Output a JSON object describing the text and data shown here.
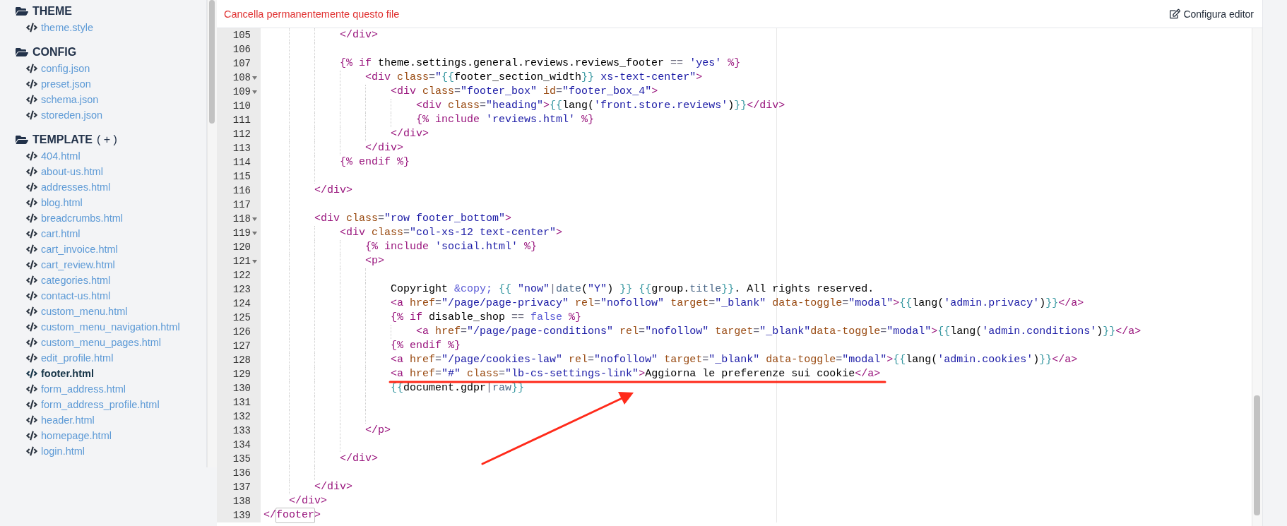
{
  "sidebar": {
    "sections": [
      {
        "title": "THEME",
        "items": [
          {
            "label": "theme.style",
            "selected": false
          }
        ]
      },
      {
        "title": "CONFIG",
        "items": [
          {
            "label": "config.json",
            "selected": false
          },
          {
            "label": "preset.json",
            "selected": false
          },
          {
            "label": "schema.json",
            "selected": false
          },
          {
            "label": "storeden.json",
            "selected": false
          }
        ]
      },
      {
        "title": "TEMPLATE",
        "action": "( + )",
        "items": [
          {
            "label": "404.html",
            "selected": false
          },
          {
            "label": "about-us.html",
            "selected": false
          },
          {
            "label": "addresses.html",
            "selected": false
          },
          {
            "label": "blog.html",
            "selected": false
          },
          {
            "label": "breadcrumbs.html",
            "selected": false
          },
          {
            "label": "cart.html",
            "selected": false
          },
          {
            "label": "cart_invoice.html",
            "selected": false
          },
          {
            "label": "cart_review.html",
            "selected": false
          },
          {
            "label": "categories.html",
            "selected": false
          },
          {
            "label": "contact-us.html",
            "selected": false
          },
          {
            "label": "custom_menu.html",
            "selected": false
          },
          {
            "label": "custom_menu_navigation.html",
            "selected": false
          },
          {
            "label": "custom_menu_pages.html",
            "selected": false
          },
          {
            "label": "edit_profile.html",
            "selected": false
          },
          {
            "label": "footer.html",
            "selected": true
          },
          {
            "label": "form_address.html",
            "selected": false
          },
          {
            "label": "form_address_profile.html",
            "selected": false
          },
          {
            "label": "header.html",
            "selected": false
          },
          {
            "label": "homepage.html",
            "selected": false
          },
          {
            "label": "login.html",
            "selected": false
          }
        ]
      }
    ]
  },
  "header": {
    "delete_link": "Cancella permanentemente questo file",
    "config_button": "Configura editor"
  },
  "editor": {
    "lines": [
      {
        "number": "105",
        "foldable": false,
        "code": [
          {
            "kind": "tag",
            "text": "            </div>"
          }
        ]
      },
      {
        "number": "106",
        "foldable": false
      },
      {
        "number": "107",
        "foldable": false,
        "code": [
          {
            "kind": "tag",
            "text": "            {%"
          },
          {
            "kind": "tag",
            "text": " if"
          },
          {
            "kind": "text",
            "text": " theme.settings.general.reviews.reviews_footer"
          },
          {
            "kind": "op",
            "text": " =="
          },
          {
            "kind": "str",
            "text": " 'yes'"
          },
          {
            "kind": "tag",
            "text": " %}"
          }
        ]
      },
      {
        "number": "108",
        "foldable": true,
        "code": [
          {
            "kind": "tag",
            "text": "                <div"
          },
          {
            "kind": "attr",
            "text": " class"
          },
          {
            "kind": "op",
            "text": "="
          },
          {
            "kind": "str",
            "text": "\""
          },
          {
            "kind": "brace",
            "text": "{{"
          },
          {
            "kind": "text",
            "text": "footer_section_width"
          },
          {
            "kind": "brace",
            "text": "}}"
          },
          {
            "kind": "str",
            "text": " xs-text-center\""
          },
          {
            "kind": "tag",
            "text": ">"
          }
        ]
      },
      {
        "number": "109",
        "foldable": true,
        "code": [
          {
            "kind": "tag",
            "text": "                    <div"
          },
          {
            "kind": "attr",
            "text": " class"
          },
          {
            "kind": "op",
            "text": "="
          },
          {
            "kind": "str",
            "text": "\"footer_box\""
          },
          {
            "kind": "attr",
            "text": " id"
          },
          {
            "kind": "op",
            "text": "="
          },
          {
            "kind": "str",
            "text": "\"footer_box_4\""
          },
          {
            "kind": "tag",
            "text": ">"
          }
        ]
      },
      {
        "number": "110",
        "foldable": false,
        "code": [
          {
            "kind": "tag",
            "text": "                        <div"
          },
          {
            "kind": "attr",
            "text": " class"
          },
          {
            "kind": "op",
            "text": "="
          },
          {
            "kind": "str",
            "text": "\"heading\""
          },
          {
            "kind": "tag",
            "text": ">"
          },
          {
            "kind": "brace",
            "text": "{{"
          },
          {
            "kind": "text",
            "text": "lang("
          },
          {
            "kind": "str",
            "text": "'front.store.reviews'"
          },
          {
            "kind": "text",
            "text": ")"
          },
          {
            "kind": "brace",
            "text": "}}"
          },
          {
            "kind": "tag",
            "text": "</div>"
          }
        ]
      },
      {
        "number": "111",
        "foldable": false,
        "code": [
          {
            "kind": "tag",
            "text": "                        {%"
          },
          {
            "kind": "tag",
            "text": " include"
          },
          {
            "kind": "str",
            "text": " 'reviews.html'"
          },
          {
            "kind": "tag",
            "text": " %}"
          }
        ]
      },
      {
        "number": "112",
        "foldable": false,
        "code": [
          {
            "kind": "tag",
            "text": "                    </div>"
          }
        ]
      },
      {
        "number": "113",
        "foldable": false,
        "code": [
          {
            "kind": "tag",
            "text": "                </div>"
          }
        ]
      },
      {
        "number": "114",
        "foldable": false,
        "code": [
          {
            "kind": "tag",
            "text": "            {%"
          },
          {
            "kind": "tag",
            "text": " endif"
          },
          {
            "kind": "tag",
            "text": " %}"
          }
        ]
      },
      {
        "number": "115",
        "foldable": false
      },
      {
        "number": "116",
        "foldable": false,
        "code": [
          {
            "kind": "tag",
            "text": "        </div>"
          }
        ]
      },
      {
        "number": "117",
        "foldable": false
      },
      {
        "number": "118",
        "foldable": true,
        "code": [
          {
            "kind": "tag",
            "text": "        <div"
          },
          {
            "kind": "attr",
            "text": " class"
          },
          {
            "kind": "op",
            "text": "="
          },
          {
            "kind": "str",
            "text": "\"row footer_bottom\""
          },
          {
            "kind": "tag",
            "text": ">"
          }
        ]
      },
      {
        "number": "119",
        "foldable": true,
        "code": [
          {
            "kind": "tag",
            "text": "            <div"
          },
          {
            "kind": "attr",
            "text": " class"
          },
          {
            "kind": "op",
            "text": "="
          },
          {
            "kind": "str",
            "text": "\"col-xs-12 text-center\""
          },
          {
            "kind": "tag",
            "text": ">"
          }
        ]
      },
      {
        "number": "120",
        "foldable": false,
        "code": [
          {
            "kind": "tag",
            "text": "                {%"
          },
          {
            "kind": "tag",
            "text": " include"
          },
          {
            "kind": "str",
            "text": " 'social.html'"
          },
          {
            "kind": "tag",
            "text": " %}"
          }
        ]
      },
      {
        "number": "121",
        "foldable": true,
        "code": [
          {
            "kind": "tag",
            "text": "                <p>"
          }
        ]
      },
      {
        "number": "122",
        "foldable": false
      },
      {
        "number": "123",
        "foldable": false,
        "code": [
          {
            "kind": "text",
            "text": "                    Copyright"
          },
          {
            "kind": "atom",
            "text": " &copy;"
          },
          {
            "kind": "brace",
            "text": " {{"
          },
          {
            "kind": "str",
            "text": " \"now\""
          },
          {
            "kind": "op",
            "text": "|"
          },
          {
            "kind": "prop",
            "text": "date"
          },
          {
            "kind": "text",
            "text": "("
          },
          {
            "kind": "str",
            "text": "\"Y\""
          },
          {
            "kind": "text",
            "text": ")"
          },
          {
            "kind": "brace",
            "text": " }}"
          },
          {
            "kind": "brace",
            "text": " {{"
          },
          {
            "kind": "text",
            "text": "group."
          },
          {
            "kind": "prop",
            "text": "title"
          },
          {
            "kind": "brace",
            "text": "}}"
          },
          {
            "kind": "text",
            "text": ". All rights reserved."
          }
        ]
      },
      {
        "number": "124",
        "foldable": false,
        "code": [
          {
            "kind": "tag",
            "text": "                    <a"
          },
          {
            "kind": "attr",
            "text": " href"
          },
          {
            "kind": "op",
            "text": "="
          },
          {
            "kind": "str",
            "text": "\"/page/page-privacy\""
          },
          {
            "kind": "attr",
            "text": " rel"
          },
          {
            "kind": "op",
            "text": "="
          },
          {
            "kind": "str",
            "text": "\"nofollow\""
          },
          {
            "kind": "attr",
            "text": " target"
          },
          {
            "kind": "op",
            "text": "="
          },
          {
            "kind": "str",
            "text": "\"_blank\""
          },
          {
            "kind": "attr",
            "text": " data-toggle"
          },
          {
            "kind": "op",
            "text": "="
          },
          {
            "kind": "str",
            "text": "\"modal\""
          },
          {
            "kind": "tag",
            "text": ">"
          },
          {
            "kind": "brace",
            "text": "{{"
          },
          {
            "kind": "text",
            "text": "lang("
          },
          {
            "kind": "str",
            "text": "'admin.privacy'"
          },
          {
            "kind": "text",
            "text": ")"
          },
          {
            "kind": "brace",
            "text": "}}"
          },
          {
            "kind": "tag",
            "text": "</a>"
          }
        ]
      },
      {
        "number": "125",
        "foldable": false,
        "code": [
          {
            "kind": "tag",
            "text": "                    {%"
          },
          {
            "kind": "tag",
            "text": " if"
          },
          {
            "kind": "text",
            "text": " disable_shop"
          },
          {
            "kind": "op",
            "text": " =="
          },
          {
            "kind": "atom",
            "text": " false"
          },
          {
            "kind": "tag",
            "text": " %}"
          }
        ]
      },
      {
        "number": "126",
        "foldable": false,
        "code": [
          {
            "kind": "tag",
            "text": "                        <a"
          },
          {
            "kind": "attr",
            "text": " href"
          },
          {
            "kind": "op",
            "text": "="
          },
          {
            "kind": "str",
            "text": "\"/page/page-conditions\""
          },
          {
            "kind": "attr",
            "text": " rel"
          },
          {
            "kind": "op",
            "text": "="
          },
          {
            "kind": "str",
            "text": "\"nofollow\""
          },
          {
            "kind": "attr",
            "text": " target"
          },
          {
            "kind": "op",
            "text": "="
          },
          {
            "kind": "str",
            "text": "\"_blank\""
          },
          {
            "kind": "attr",
            "text": "data-toggle"
          },
          {
            "kind": "op",
            "text": "="
          },
          {
            "kind": "str",
            "text": "\"modal\""
          },
          {
            "kind": "tag",
            "text": ">"
          },
          {
            "kind": "brace",
            "text": "{{"
          },
          {
            "kind": "text",
            "text": "lang("
          },
          {
            "kind": "str",
            "text": "'admin.conditions'"
          },
          {
            "kind": "text",
            "text": ")"
          },
          {
            "kind": "brace",
            "text": "}}"
          },
          {
            "kind": "tag",
            "text": "</a>"
          }
        ]
      },
      {
        "number": "127",
        "foldable": false,
        "code": [
          {
            "kind": "tag",
            "text": "                    {%"
          },
          {
            "kind": "tag",
            "text": " endif"
          },
          {
            "kind": "tag",
            "text": " %}"
          }
        ]
      },
      {
        "number": "128",
        "foldable": false,
        "code": [
          {
            "kind": "tag",
            "text": "                    <a"
          },
          {
            "kind": "attr",
            "text": " href"
          },
          {
            "kind": "op",
            "text": "="
          },
          {
            "kind": "str",
            "text": "\"/page/cookies-law\""
          },
          {
            "kind": "attr",
            "text": " rel"
          },
          {
            "kind": "op",
            "text": "="
          },
          {
            "kind": "str",
            "text": "\"nofollow\""
          },
          {
            "kind": "attr",
            "text": " target"
          },
          {
            "kind": "op",
            "text": "="
          },
          {
            "kind": "str",
            "text": "\"_blank\""
          },
          {
            "kind": "attr",
            "text": " data-toggle"
          },
          {
            "kind": "op",
            "text": "="
          },
          {
            "kind": "str",
            "text": "\"modal\""
          },
          {
            "kind": "tag",
            "text": ">"
          },
          {
            "kind": "brace",
            "text": "{{"
          },
          {
            "kind": "text",
            "text": "lang("
          },
          {
            "kind": "str",
            "text": "'admin.cookies'"
          },
          {
            "kind": "text",
            "text": ")"
          },
          {
            "kind": "brace",
            "text": "}}"
          },
          {
            "kind": "tag",
            "text": "</a>"
          }
        ]
      },
      {
        "number": "129",
        "foldable": false,
        "code": [
          {
            "kind": "tag",
            "text": "                    <a"
          },
          {
            "kind": "attr",
            "text": " href"
          },
          {
            "kind": "op",
            "text": "="
          },
          {
            "kind": "str",
            "text": "\"#\""
          },
          {
            "kind": "attr",
            "text": " class"
          },
          {
            "kind": "op",
            "text": "="
          },
          {
            "kind": "str",
            "text": "\"lb-cs-settings-link\""
          },
          {
            "kind": "tag",
            "text": ">"
          },
          {
            "kind": "text",
            "text": "Aggiorna le preferenze sui cookie"
          },
          {
            "kind": "tag",
            "text": "</a>"
          }
        ]
      },
      {
        "number": "130",
        "foldable": false,
        "code": [
          {
            "kind": "brace",
            "text": "                    {{"
          },
          {
            "kind": "text",
            "text": "document.gdpr"
          },
          {
            "kind": "op",
            "text": "|"
          },
          {
            "kind": "prop",
            "text": "raw"
          },
          {
            "kind": "brace",
            "text": "}}"
          }
        ]
      },
      {
        "number": "131",
        "foldable": false
      },
      {
        "number": "132",
        "foldable": false
      },
      {
        "number": "133",
        "foldable": false,
        "code": [
          {
            "kind": "tag",
            "text": "                </p>"
          }
        ]
      },
      {
        "number": "134",
        "foldable": false
      },
      {
        "number": "135",
        "foldable": false,
        "code": [
          {
            "kind": "tag",
            "text": "            </div>"
          }
        ]
      },
      {
        "number": "136",
        "foldable": false
      },
      {
        "number": "137",
        "foldable": false,
        "code": [
          {
            "kind": "tag",
            "text": "        </div>"
          }
        ]
      },
      {
        "number": "138",
        "foldable": false,
        "code": [
          {
            "kind": "tag",
            "text": "    </div>"
          }
        ]
      },
      {
        "number": "139",
        "foldable": false,
        "code": [
          {
            "kind": "tag",
            "text": "</"
          },
          {
            "kind": "match",
            "text": "footer"
          },
          {
            "kind": "tag",
            "text": ">"
          }
        ]
      }
    ]
  }
}
